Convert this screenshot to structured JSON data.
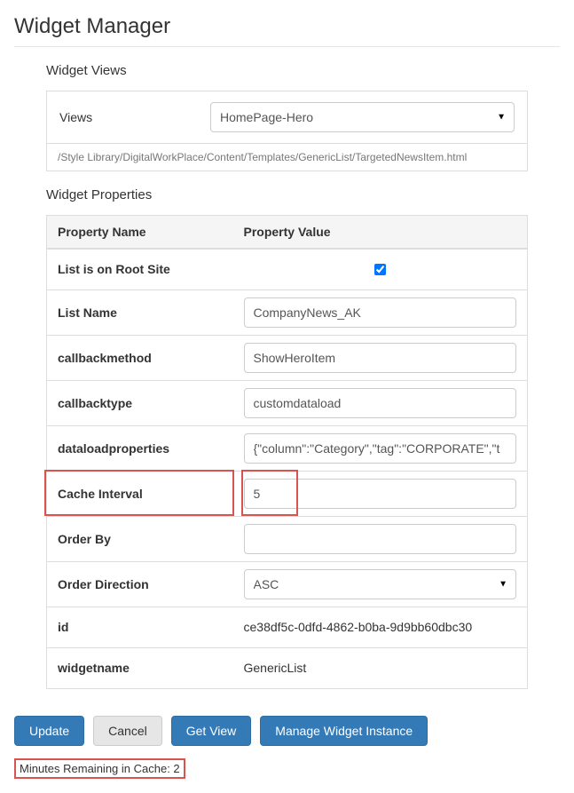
{
  "page_title": "Widget Manager",
  "views_section": {
    "heading": "Widget Views",
    "label": "Views",
    "selected": "HomePage-Hero",
    "template_path": "/Style Library/DigitalWorkPlace/Content/Templates/GenericList/TargetedNewsItem.html"
  },
  "properties_section": {
    "heading": "Widget Properties",
    "col_name": "Property Name",
    "col_value": "Property Value",
    "rows": {
      "root_site": {
        "label": "List is on Root Site",
        "checked": true
      },
      "list_name": {
        "label": "List Name",
        "value": "CompanyNews_AK"
      },
      "callbackmethod": {
        "label": "callbackmethod",
        "value": "ShowHeroItem"
      },
      "callbacktype": {
        "label": "callbacktype",
        "value": "customdataload"
      },
      "dataloadproperties": {
        "label": "dataloadproperties",
        "value": "{\"column\":\"Category\",\"tag\":\"CORPORATE\",\"t"
      },
      "cache_interval": {
        "label": "Cache Interval",
        "value": "5"
      },
      "order_by": {
        "label": "Order By",
        "value": ""
      },
      "order_direction": {
        "label": "Order Direction",
        "value": "ASC"
      },
      "id": {
        "label": "id",
        "value": "ce38df5c-0dfd-4862-b0ba-9d9bb60dbc30"
      },
      "widgetname": {
        "label": "widgetname",
        "value": "GenericList"
      }
    }
  },
  "buttons": {
    "update": "Update",
    "cancel": "Cancel",
    "get_view": "Get View",
    "manage": "Manage Widget Instance"
  },
  "cache_status": "Minutes Remaining in Cache: 2"
}
